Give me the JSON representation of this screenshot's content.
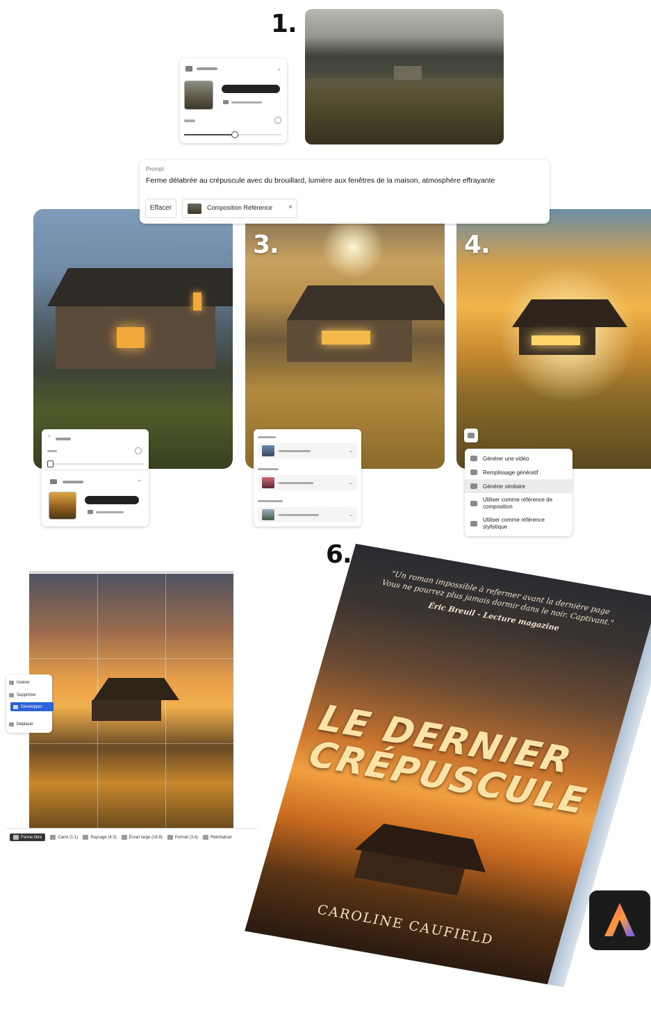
{
  "steps": {
    "s1": "1.",
    "s3": "3.",
    "s4": "4.",
    "s6": "6."
  },
  "prompt_panel": {
    "label": "Prompt",
    "text": "Ferme délabrée au crépuscule avec du brouillard, lumière aux fenêtres de la maison, atmosphère effrayante",
    "clear_button": "Effacer",
    "chip_label": "Composition Référence"
  },
  "context_menu": {
    "items": [
      {
        "label": "Générer une vidéo"
      },
      {
        "label": "Remplissage génératif"
      },
      {
        "label": "Générer similaire"
      },
      {
        "label": "Utiliser comme référence de composition"
      },
      {
        "label": "Utiliser comme référence stylistique"
      }
    ],
    "highlighted_index": 2
  },
  "crop_tools": {
    "items": [
      {
        "label": "Insérer"
      },
      {
        "label": "Supprimer"
      },
      {
        "label": "Développer"
      },
      {
        "label": "Déplacer"
      }
    ],
    "active_index": 2
  },
  "aspect_bar": {
    "items": [
      {
        "label": "Forme libre"
      },
      {
        "label": "Carré (1:1)"
      },
      {
        "label": "Paysage (4:3)"
      },
      {
        "label": "Écran large (16:9)"
      },
      {
        "label": "Portrait (3:4)"
      },
      {
        "label": "Réinitialiser"
      }
    ],
    "active_index": 0
  },
  "book": {
    "quote_line1": "\"Un roman impossible à refermer avant la dernière page",
    "quote_line2": "Vous ne pourrez plus jamais dormir dans le noir. Captivant.\"",
    "quote_author": "Éric Breuil - Lecture magazine",
    "title_line1": "LE DERNIER",
    "title_line2": "CRÉPUSCULE",
    "author": "CAROLINE CAUFIELD"
  },
  "colors": {
    "accent": "#2c63d8",
    "menu_highlight": "#ececec",
    "adobe_tile": "#1b1b1b"
  }
}
